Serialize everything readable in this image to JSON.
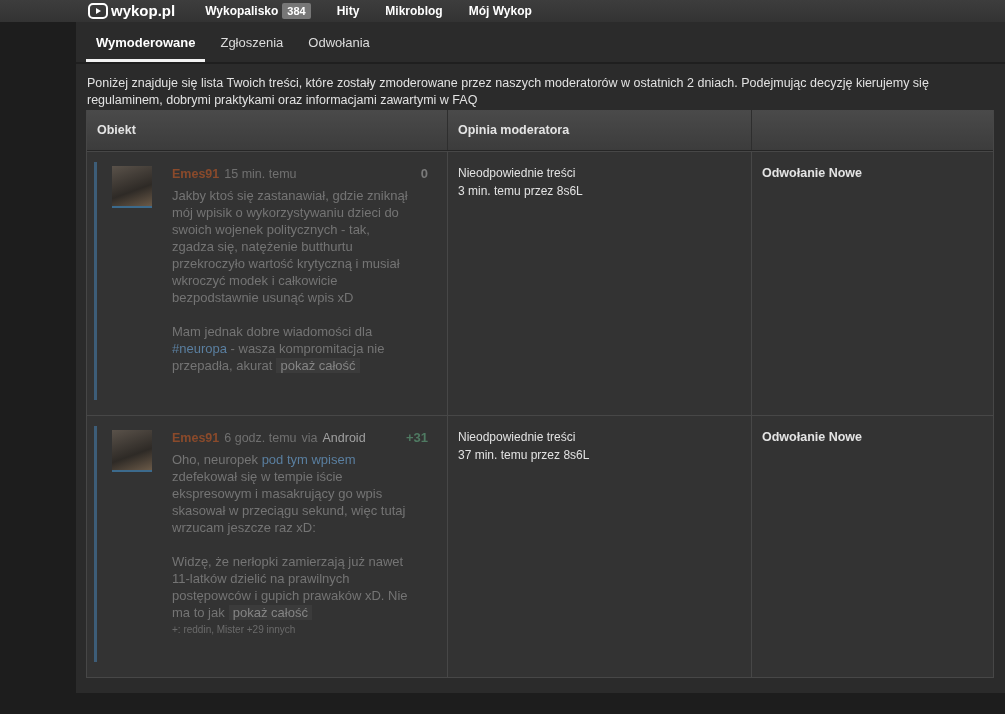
{
  "top_nav": {
    "logo": "wykop.pl",
    "items": [
      {
        "label": "Wykopalisko",
        "badge": "384"
      },
      {
        "label": "Hity"
      },
      {
        "label": "Mikroblog"
      },
      {
        "label": "Mój Wykop"
      }
    ]
  },
  "tabs": [
    {
      "label": "Wymoderowane",
      "selected": true
    },
    {
      "label": "Zgłoszenia",
      "selected": false
    },
    {
      "label": "Odwołania",
      "selected": false
    }
  ],
  "description": "Poniżej znajduje się lista Twoich treści, które zostały zmoderowane przez naszych moderatorów w ostatnich 2 dniach. Podejmując decyzję kierujemy się regulaminem, dobrymi praktykami oraz informacjami zawartymi w FAQ",
  "table": {
    "columns": [
      "Obiekt",
      "Opinia moderatora"
    ],
    "rows": [
      {
        "entry": {
          "author": "Emes91",
          "time": "15 min. temu",
          "vote": {
            "value": "0",
            "positive": false
          },
          "paragraphs": [
            [
              {
                "kind": "text",
                "text": "Jakby ktoś się zastanawiał, gdzie zniknął mój wpisik o wykorzystywaniu dzieci do swoich wojenek politycznych - tak, zgadza się, natężenie butthurtu przekroczyło wartość krytyczną i musiał wkroczyć modek i całkowicie bezpodstawnie usunąć wpis xD"
              }
            ],
            [
              {
                "kind": "text",
                "text": "Mam jednak dobre wiadomości dla "
              },
              {
                "kind": "link",
                "text": "#neuropa"
              },
              {
                "kind": "text",
                "text": " - wasza kompromitacja nie przepadła, akurat"
              }
            ]
          ],
          "more_button": "pokaż całość"
        },
        "reason": "Nieodpowiednie treści",
        "moderation": "3 min. temu przez 8s6L",
        "appeal": "Odwołanie Nowe"
      },
      {
        "entry": {
          "author": "Emes91",
          "time": "6 godz. temu",
          "client": {
            "prefix": "via",
            "name": "Android"
          },
          "vote": {
            "value": "+31",
            "positive": true
          },
          "paragraphs": [
            [
              {
                "kind": "text",
                "text": "Oho, neuropek "
              },
              {
                "kind": "link",
                "text": "pod tym wpisem"
              },
              {
                "kind": "text",
                "text": " zdefekował się w tempie iście ekspresowym i masakrujący go wpis skasował w przeciągu sekund, więc tutaj wrzucam jeszcze raz xD:"
              }
            ],
            [
              {
                "kind": "text",
                "text": "Widzę, że nerłopki zamierzają już nawet 11-latków dzielić na prawilnych postępowców i gupich prawaków xD. Nie ma to jak"
              }
            ]
          ],
          "more_button": "pokaż całość",
          "voters": "+: reddin, Mister +29 innych"
        },
        "reason": "Nieodpowiednie treści",
        "moderation": "37 min. temu przez 8s6L",
        "appeal": "Odwołanie Nowe"
      }
    ]
  }
}
